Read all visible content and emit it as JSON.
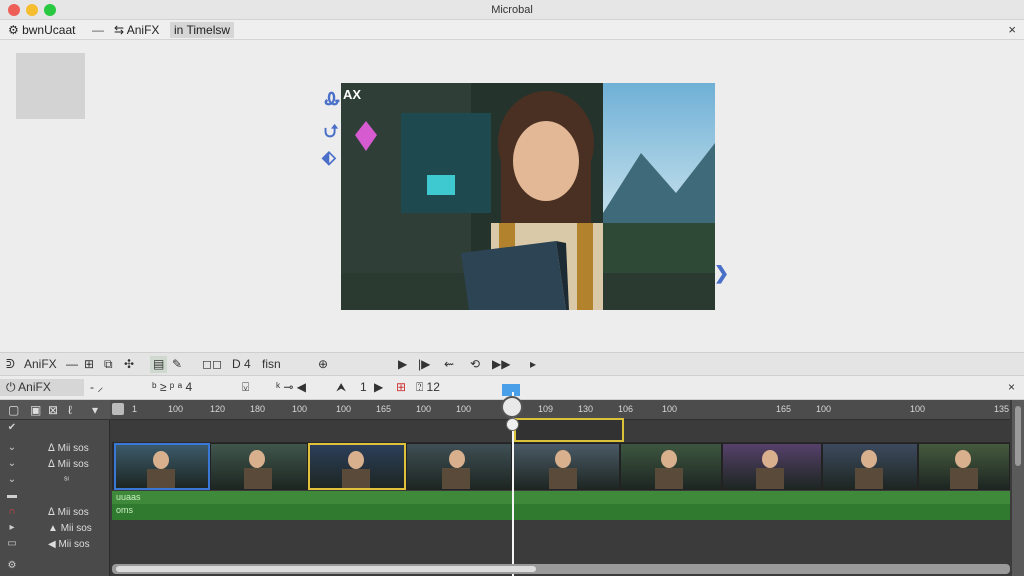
{
  "window": {
    "title": "Microbal"
  },
  "tabs": [
    {
      "label": "bwnUcaat"
    },
    {
      "label": "AniFX"
    },
    {
      "label": "Timelsw",
      "prefix": "in"
    }
  ],
  "preview": {
    "overlay_label": "AX"
  },
  "toolbar": {
    "label": "AniFX",
    "text_field": "fisn"
  },
  "timeline": {
    "panel_label": "AniFX",
    "ruler_ticks": [
      "1",
      "100",
      "120",
      "180",
      "100",
      "100",
      "165",
      "100",
      "100",
      "109",
      "130",
      "106",
      "100",
      "165",
      "100",
      "100",
      "135"
    ],
    "tracks": [
      {
        "label": "Mii sos"
      },
      {
        "label": "Mii sos"
      },
      {
        "label": "Mii sos"
      },
      {
        "label": "Mii sos"
      },
      {
        "label": "Mii sos"
      }
    ],
    "green_tracks": [
      {
        "label": "uuaas"
      },
      {
        "label": "oms"
      }
    ],
    "clip_colors": [
      "#3b5a6a",
      "#40564c",
      "#2c3f5a",
      "#3f4f55",
      "#4b5a66",
      "#3d5640",
      "#56406a",
      "#3d4a5e",
      "#455a3e",
      "#5a5a4a"
    ]
  },
  "colors": {
    "accent": "#3a78d8",
    "selection": "#e0c13a",
    "track_green": "#3e8a3a"
  }
}
